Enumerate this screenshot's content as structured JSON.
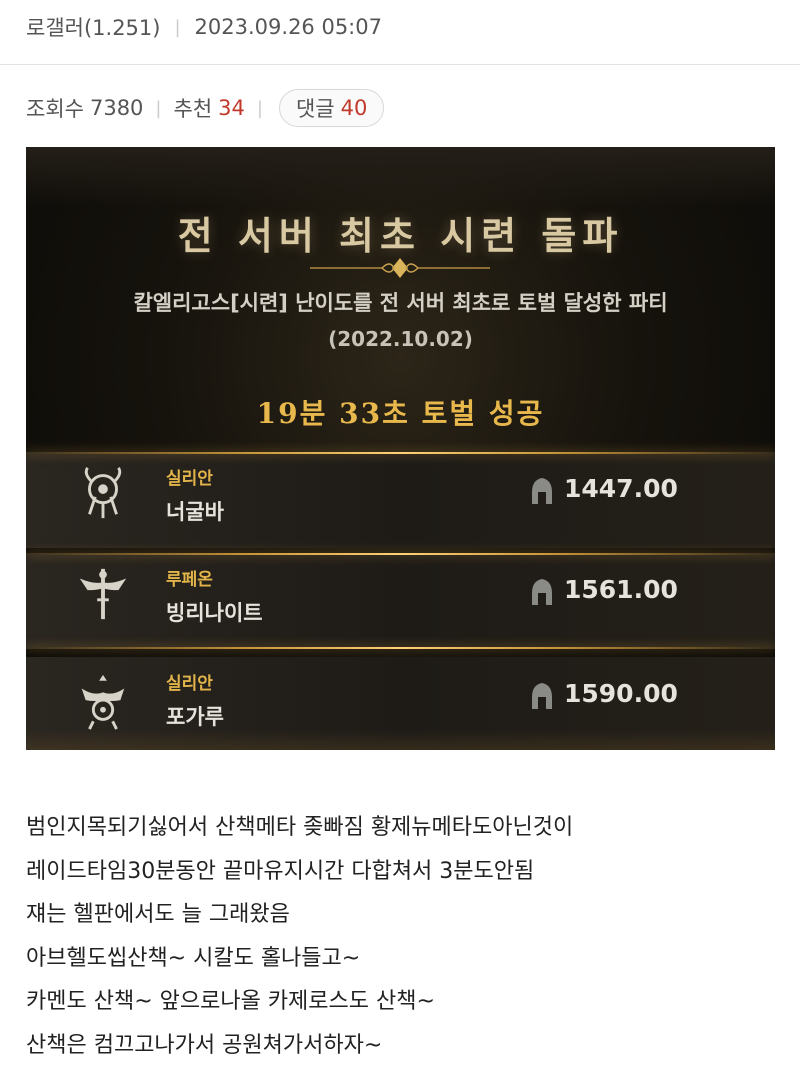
{
  "header": {
    "author": "로갤러(1.251)",
    "datetime": "2023.09.26 05:07"
  },
  "stats": {
    "views_label": "조회수",
    "views": "7380",
    "recommend_label": "추천",
    "recommend": "34",
    "comments_label": "댓글",
    "comments": "40"
  },
  "game_image": {
    "title": "전 서버 최초 시련 돌파",
    "description": "칼엘리고스[시련] 난이도를 전 서버 최초로 토벌 달성한 파티",
    "date": "(2022.10.02)",
    "clear_time": "19분 33초 토벌 성공",
    "members": [
      {
        "server": "실리안",
        "name": "너굴바",
        "score": "1447.00",
        "class_icon": "destroyer-class-icon"
      },
      {
        "server": "루페온",
        "name": "빙리나이트",
        "score": "1561.00",
        "class_icon": "paladin-class-icon"
      },
      {
        "server": "실리안",
        "name": "포가루",
        "score": "1590.00",
        "class_icon": "bard-class-icon"
      }
    ],
    "accent_color": "#e2b44a"
  },
  "body_lines": [
    "범인지목되기싫어서 산책메타 좆빠짐 황제뉴메타도아닌것이",
    "레이드타임30분동안 끝마유지시간 다합쳐서 3분도안됨",
    "쟤는 헬판에서도 늘 그래왔음",
    "아브헬도씹산책~ 시칼도 홀나들고~",
    "카멘도 산책~ 앞으로나올 카제로스도 산책~",
    "산책은 컴끄고나가서 공원쳐가서하자~"
  ]
}
